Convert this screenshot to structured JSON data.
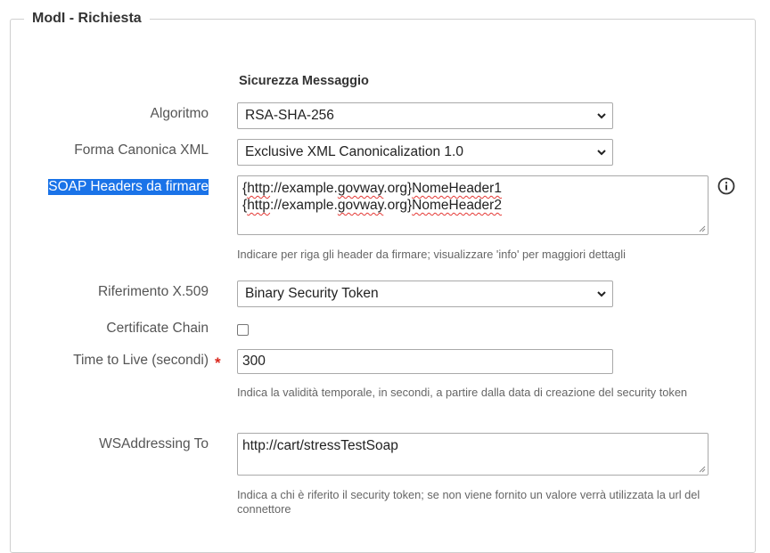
{
  "fieldset": {
    "legend": "ModI - Richiesta"
  },
  "section": {
    "title": "Sicurezza Messaggio"
  },
  "fields": {
    "algoritmo": {
      "label": "Algoritmo",
      "value": "RSA-SHA-256"
    },
    "forma_canonica": {
      "label": "Forma Canonica XML",
      "value": "Exclusive XML Canonicalization 1.0"
    },
    "soap_headers": {
      "label": "SOAP Headers da firmare",
      "line1_prefix": "{",
      "line1_link": "http",
      "line1_mid": "://example.",
      "line1_word": "govway",
      "line1_suffix": ".org}",
      "line1_name": "NomeHeader1",
      "line2_prefix": "{",
      "line2_link": "http",
      "line2_mid": "://example.",
      "line2_word": "govway",
      "line2_suffix": ".org}",
      "line2_name": "NomeHeader2",
      "hint": "Indicare per riga gli header da firmare; visualizzare 'info' per maggiori dettagli"
    },
    "riferimento": {
      "label": "Riferimento X.509",
      "value": "Binary Security Token"
    },
    "certificate_chain": {
      "label": "Certificate Chain",
      "checked": false
    },
    "ttl": {
      "label": "Time to Live (secondi)",
      "required_mark": "*",
      "value": "300",
      "hint": "Indica la validità temporale, in secondi, a partire dalla data di creazione del security token"
    },
    "wsaddressing": {
      "label": "WSAddressing To",
      "value": "http://cart/stressTestSoap",
      "hint": "Indica a chi è riferito il security token; se non viene fornito un valore verrà utilizzata la url del connettore"
    }
  },
  "icons": {
    "select_arrow": "chevron-down-icon",
    "info": "info-circle-icon"
  },
  "colors": {
    "selection": "#1a73e8",
    "required": "#d9261c",
    "border": "#a9a9a9"
  }
}
